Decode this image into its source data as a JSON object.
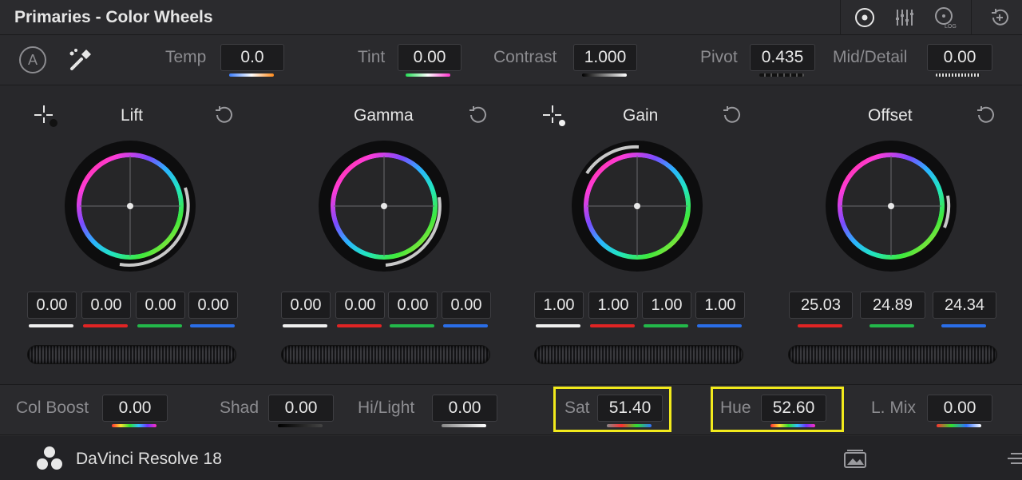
{
  "header": {
    "title": "Primaries - Color Wheels",
    "icons": [
      "color-wheels-icon",
      "bars-icon",
      "log-icon",
      "reset-all-icon"
    ],
    "log_label": "LOG"
  },
  "adjustments": {
    "auto_label": "A",
    "temp": {
      "label": "Temp",
      "value": "0.0"
    },
    "tint": {
      "label": "Tint",
      "value": "0.00"
    },
    "contrast": {
      "label": "Contrast",
      "value": "1.000"
    },
    "pivot": {
      "label": "Pivot",
      "value": "0.435"
    },
    "middetail": {
      "label": "Mid/Detail",
      "value": "0.00"
    }
  },
  "wheels": {
    "lift": {
      "label": "Lift",
      "values": [
        "0.00",
        "0.00",
        "0.00",
        "0.00"
      ]
    },
    "gamma": {
      "label": "Gamma",
      "values": [
        "0.00",
        "0.00",
        "0.00",
        "0.00"
      ]
    },
    "gain": {
      "label": "Gain",
      "values": [
        "1.00",
        "1.00",
        "1.00",
        "1.00"
      ]
    },
    "offset": {
      "label": "Offset",
      "values": [
        "25.03",
        "24.89",
        "24.34"
      ]
    }
  },
  "bottom": {
    "colboost": {
      "label": "Col Boost",
      "value": "0.00"
    },
    "shad": {
      "label": "Shad",
      "value": "0.00"
    },
    "hilight": {
      "label": "Hi/Light",
      "value": "0.00"
    },
    "sat": {
      "label": "Sat",
      "value": "51.40"
    },
    "hue": {
      "label": "Hue",
      "value": "52.60"
    },
    "lmix": {
      "label": "L. Mix",
      "value": "0.00"
    }
  },
  "footer": {
    "app_name": "DaVinci Resolve 18"
  },
  "colors": {
    "highlight": "#f2ea1c",
    "panel_bg": "#2a2a2d",
    "field_bg": "#1c1c1e"
  }
}
